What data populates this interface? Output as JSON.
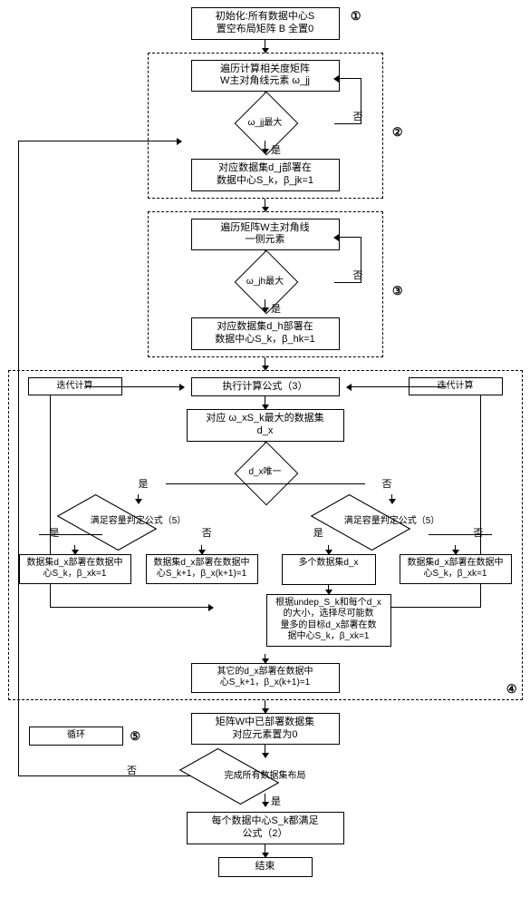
{
  "stages": {
    "s1": "①",
    "s2": "②",
    "s3": "③",
    "s4": "④",
    "s5": "⑤"
  },
  "branch": {
    "yes": "是",
    "no": "否"
  },
  "iter_label": "迭代计算",
  "loop_label": "循环",
  "n": {
    "init": "初始化:所有数据中心S\n置空布局矩阵 B 全置0",
    "trav1": "遍历计算相关度矩阵\nW主对角线元素 ω_jj",
    "d_wjj": "ω_jj最大",
    "deploy1": "对应数据集d_j部署在\n数据中心S_k，β_jk=1",
    "trav2": "遍历矩阵W主对角线\n一侧元素",
    "d_wjh": "ω_jh最大",
    "deploy2": "对应数据集d_h部署在\n数据中心S_k，β_hk=1",
    "exec3": "执行计算公式（3）",
    "maxdata": "对应 ω_xS_k最大的数据集\nd_x",
    "d_unique": "d_x唯一",
    "d_cap_l": "满足容量判定公式（5）",
    "d_cap_r": "满足容量判定公式（5）",
    "leaf_ll": "数据集d_x部署在数据中\n心S_k，β_xk=1",
    "leaf_lr": "数据集d_x部署在数据中\n心S_k+1，β_x(k+1)=1",
    "leaf_rm": "多个数据集d_x",
    "leaf_rr": "数据集d_x部署在数据中\n心S_k，β_xk=1",
    "undep": "根据undep_S_k和每个d_x\n的大小，选择尽可能数\n量多的目标d_x部署在数\n据中心S_k，β_xk=1",
    "other": "其它的d_x部署在数据中\n心S_k+1，β_x(k+1)=1",
    "reset0": "矩阵W中已部署数据集\n对应元素置为0",
    "d_alldone": "完成所有数据集布局",
    "sat2": "每个数据中心S_k都满足\n公式（2）",
    "end": "结束"
  }
}
